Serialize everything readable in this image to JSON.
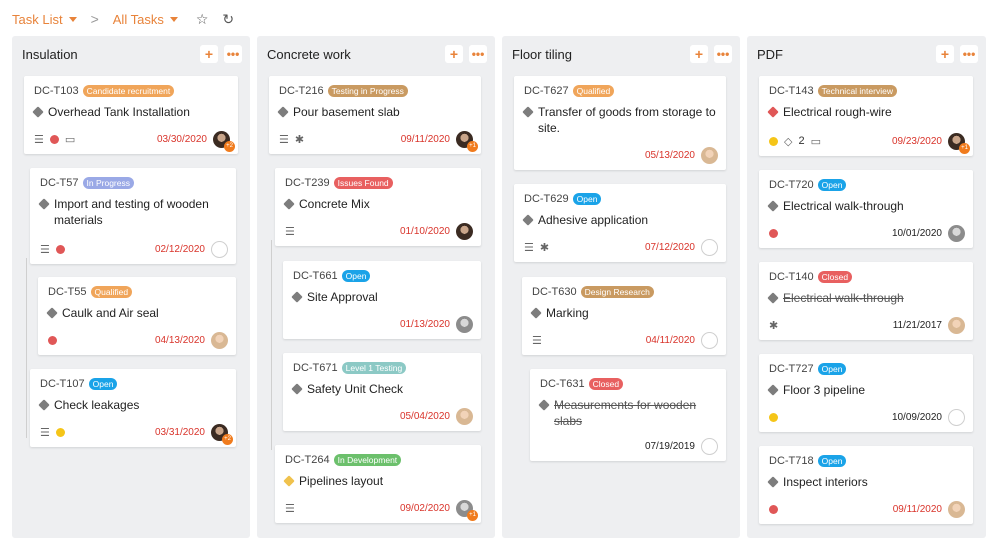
{
  "topbar": {
    "task_list": "Task List",
    "all_tasks": "All Tasks",
    "separator": ">",
    "star_icon": "star-icon",
    "refresh_icon": "refresh-icon"
  },
  "colors": {
    "accent": "#e8833a",
    "orange_badge": "#f0a55a",
    "blue_badge": "#1aa3e8",
    "lavender_badge": "#9aa9e6",
    "red_badge": "#e86060",
    "tan_badge": "#c99a61",
    "teal_badge": "#8cc9c5",
    "green_badge": "#6cc06c",
    "date_red": "#d9342b"
  },
  "columns": [
    {
      "title": "Insulation",
      "cards": [
        {
          "id": "DC-T103",
          "badge": "Candidate recruitment",
          "title": "Overhead Tank Installation",
          "date": "03/30/2020",
          "count": "+2"
        },
        {
          "id": "DC-T57",
          "badge": "In Progress",
          "title": "Import and testing of wooden materials",
          "date": "02/12/2020"
        },
        {
          "id": "DC-T55",
          "badge": "Qualified",
          "title": "Caulk and Air seal",
          "date": "04/13/2020"
        },
        {
          "id": "DC-T107",
          "badge": "Open",
          "title": "Check leakages",
          "date": "03/31/2020",
          "count": "+2"
        }
      ]
    },
    {
      "title": "Concrete work",
      "cards": [
        {
          "id": "DC-T216",
          "badge": "Testing in Progress",
          "title": "Pour basement slab",
          "date": "09/11/2020",
          "count": "+1"
        },
        {
          "id": "DC-T239",
          "badge": "Issues Found",
          "title": "Concrete Mix",
          "date": "01/10/2020"
        },
        {
          "id": "DC-T661",
          "badge": "Open",
          "title": "Site Approval",
          "date": "01/13/2020"
        },
        {
          "id": "DC-T671",
          "badge": "Level 1 Testing",
          "title": "Safety Unit Check",
          "date": "05/04/2020"
        },
        {
          "id": "DC-T264",
          "badge": "In Development",
          "title": "Pipelines layout",
          "date": "09/02/2020",
          "count": "+1"
        }
      ]
    },
    {
      "title": "Floor tiling",
      "cards": [
        {
          "id": "DC-T627",
          "badge": "Qualified",
          "title": "Transfer of goods from storage to site.",
          "date": "05/13/2020"
        },
        {
          "id": "DC-T629",
          "badge": "Open",
          "title": "Adhesive application",
          "date": "07/12/2020"
        },
        {
          "id": "DC-T630",
          "badge": "Design Research",
          "title": "Marking",
          "date": "04/11/2020"
        },
        {
          "id": "DC-T631",
          "badge": "Closed",
          "title": "Measurements for wooden slabs",
          "date": "07/19/2019"
        }
      ]
    },
    {
      "title": "PDF",
      "cards": [
        {
          "id": "DC-T143",
          "badge": "Technical interview",
          "title": "Electrical rough-wire",
          "date": "09/23/2020",
          "tags": "2",
          "count": "+1"
        },
        {
          "id": "DC-T720",
          "badge": "Open",
          "title": "Electrical walk-through",
          "date": "10/01/2020"
        },
        {
          "id": "DC-T140",
          "badge": "Closed",
          "title": "Electrical walk-through",
          "date": "11/21/2017"
        },
        {
          "id": "DC-T727",
          "badge": "Open",
          "title": "Floor 3 pipeline",
          "date": "10/09/2020"
        },
        {
          "id": "DC-T718",
          "badge": "Open",
          "title": "Inspect interiors",
          "date": "09/11/2020"
        }
      ]
    }
  ]
}
